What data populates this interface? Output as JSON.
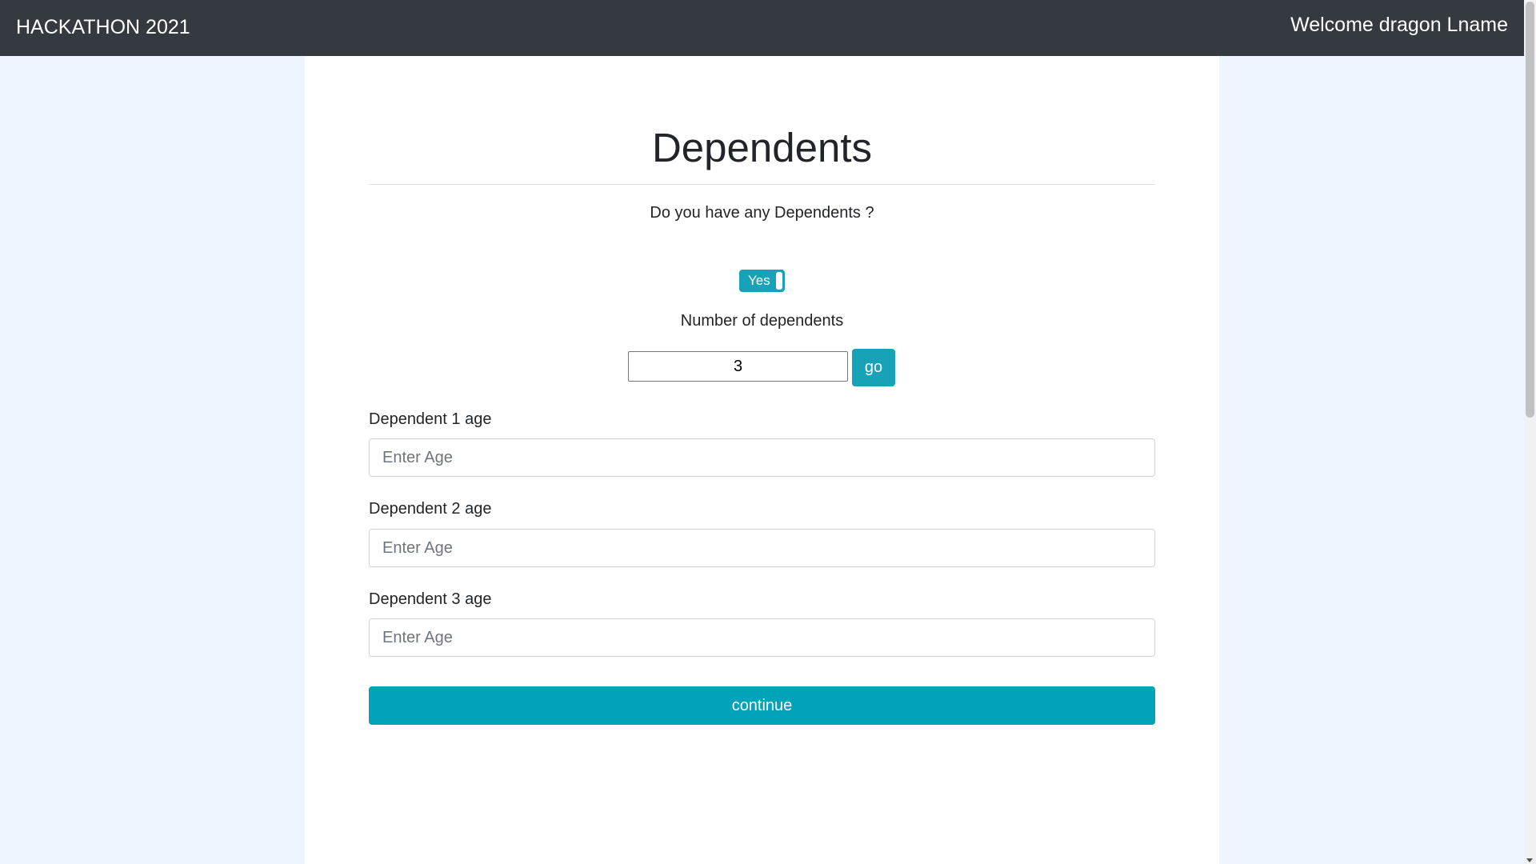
{
  "navbar": {
    "brand": "HACKATHON 2021",
    "welcome": "Welcome dragon Lname"
  },
  "page": {
    "title": "Dependents",
    "question": "Do you have any Dependents ?",
    "toggle": {
      "label": "Yes",
      "on": true
    },
    "number_label": "Number of dependents",
    "number_value": "3",
    "go_label": "go",
    "dependents": [
      {
        "label": "Dependent 1 age",
        "placeholder": "Enter Age"
      },
      {
        "label": "Dependent 2 age",
        "placeholder": "Enter Age"
      },
      {
        "label": "Dependent 3 age",
        "placeholder": "Enter Age"
      }
    ],
    "continue_label": "continue"
  },
  "colors": {
    "navbar_bg": "#343a40",
    "accent": "#17a2b8",
    "page_bg": "#eef5ff",
    "panel_bg": "#ffffff"
  }
}
